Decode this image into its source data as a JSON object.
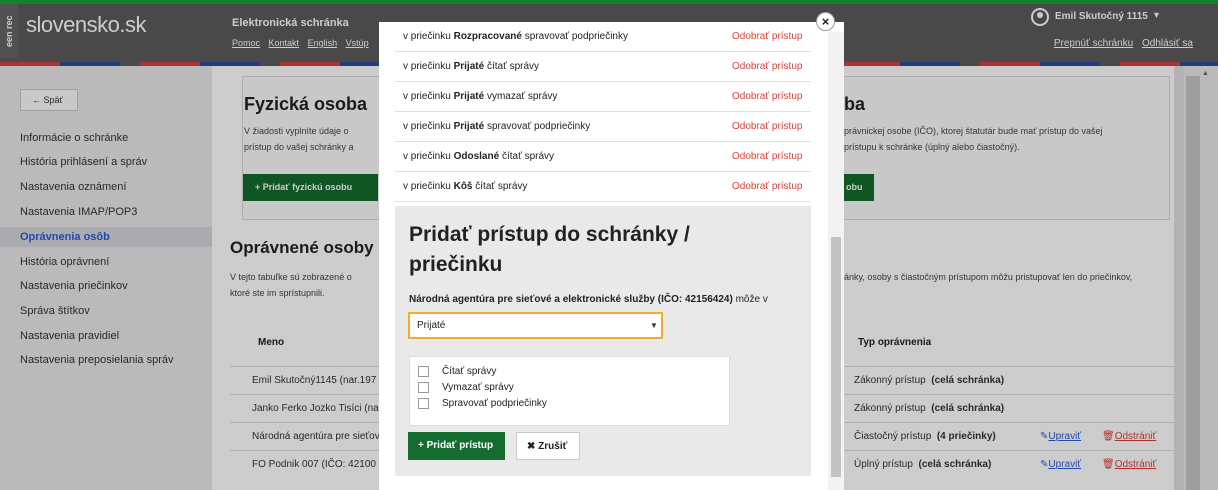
{
  "header": {
    "brand_side": "een rec",
    "logo": "slovensko.sk",
    "title": "Elektronická schránka",
    "links": [
      "Pomoc",
      "Kontakt",
      "English",
      "Vstúp"
    ],
    "user_name": "Emil Skutočný 1115",
    "user_caret": "▾",
    "right_links": [
      "Prepnúť schránku",
      "Odhlásiť sa"
    ]
  },
  "sidebar": {
    "back_label": "← Späť",
    "items": [
      "Informácie o schránke",
      "História prihlásení a správ",
      "Nastavenia oznámení",
      "Nastavenia IMAP/POP3",
      "Oprávnenia osôb",
      "História oprávnení",
      "Nastavenia priečinkov",
      "Správa štítkov",
      "Nastavenia pravidiel",
      "Nastavenia preposielania správ"
    ],
    "active_index": 4
  },
  "main": {
    "fo_title": "Fyzická osoba",
    "fo_desc_1": "V žiadosti vyplníte údaje o",
    "fo_desc_2": "prístup do vašej schránky a",
    "fo_button": "+ Pridať fyzickú osobu",
    "po_title_tail": "ba",
    "po_desc_1": "právnickej osobe (IČO), ktorej štatutár bude mať prístup do vašej",
    "po_desc_2": "prístupu k schránke (úplný alebo čiastočný).",
    "po_button_tail": "obu",
    "op_title": "Oprávnené osoby",
    "op_desc_1": "V tejto tabuľke sú zobrazené o",
    "op_desc_1_right": "ánky, osoby s čiastočným prístupom môžu pristupovať len do priečinkov,",
    "op_desc_2": "ktoré ste im sprístupnili.",
    "col_name": "Meno",
    "col_type": "Typ oprávnenia",
    "rows": [
      {
        "name": "Emil Skutočný1145 (nar.197",
        "type_plain": "Zákonný prístup",
        "type_bold": "(celá schránka)"
      },
      {
        "name": "Janko Ferko Jozko Tisíci (na",
        "type_plain": "Zákonný prístup",
        "type_bold": "(celá schránka)"
      },
      {
        "name": "Národná agentúra pre sieťov",
        "type_plain": "Čiastočný prístup",
        "type_bold": "(4 priečinky)",
        "edit": "Upraviť",
        "remove": "Odstrániť"
      },
      {
        "name": "FO Podnik 007 (IČO: 42100",
        "type_plain": "Úplný prístup",
        "type_bold": "(celá schránka)",
        "edit": "Upraviť",
        "remove": "Odstrániť"
      }
    ]
  },
  "modal": {
    "close_label": "×",
    "permissions": [
      {
        "prefix": "v priečinku",
        "folder": "Rozpracované",
        "action": "spravovať podpriečinky",
        "remove": "Odobrať prístup"
      },
      {
        "prefix": "v priečinku",
        "folder": "Prijaté",
        "action": "čítať správy",
        "remove": "Odobrať prístup"
      },
      {
        "prefix": "v priečinku",
        "folder": "Prijaté",
        "action": "vymazať správy",
        "remove": "Odobrať prístup"
      },
      {
        "prefix": "v priečinku",
        "folder": "Prijaté",
        "action": "spravovať podpriečinky",
        "remove": "Odobrať prístup"
      },
      {
        "prefix": "v priečinku",
        "folder": "Odoslané",
        "action": "čítať správy",
        "remove": "Odobrať prístup"
      },
      {
        "prefix": "v priečinku",
        "folder": "Kôš",
        "action": "čítať správy",
        "remove": "Odobrať prístup"
      }
    ],
    "add_title": "Pridať prístup do schránky / priečinku",
    "subject_bold": "Národná agentúra pre sieťové a elektronické služby (IČO: 42156424)",
    "subject_tail": "môže v",
    "folder_selected": "Prijaté",
    "select_caret": "▼",
    "checkboxes": [
      "Čítať správy",
      "Vymazať správy",
      "Spravovať podpriečinky"
    ],
    "add_button": "+ Pridať prístup",
    "cancel_button": "✖ Zrušiť"
  },
  "colors": {
    "accent_green": "#146c2e",
    "header_gray": "#5c5c5c",
    "link_red": "#d8423c",
    "focus_orange": "#f0ad2a"
  }
}
